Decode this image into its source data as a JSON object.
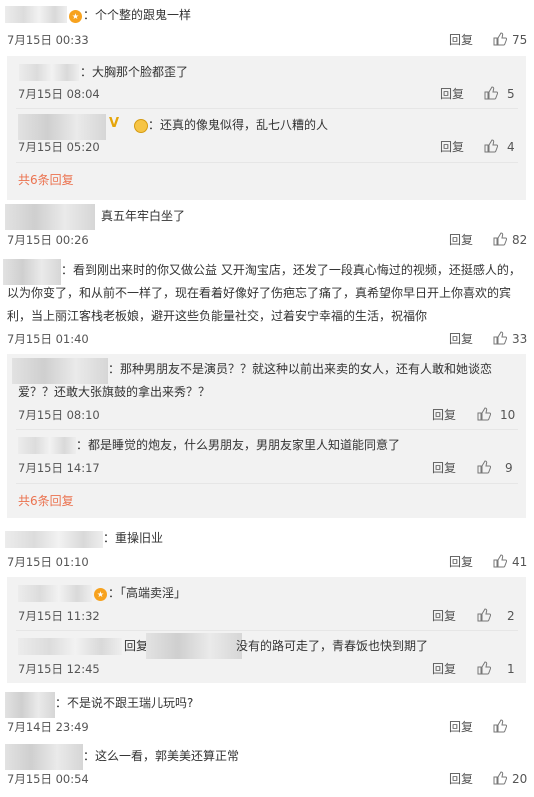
{
  "actions": {
    "reply": "回复"
  },
  "comments": [
    {
      "text": "：个个整的跟鬼一样",
      "time": "7月15日 00:33",
      "likes": "75",
      "subs": [
        {
          "text": "：大胸那个脸都歪了",
          "time": "7月15日 08:04",
          "likes": "5"
        },
        {
          "mark": "V",
          "text": "：还真的像鬼似得，乱七八糟的人",
          "time": "7月15日 05:20",
          "likes": "4"
        }
      ],
      "more": "共6条回复"
    },
    {
      "text": "真五年牢白坐了",
      "time": "7月15日 00:26",
      "likes": "82"
    },
    {
      "lines": [
        "：看到刚出来时的你又做公益 又开淘宝店，还发了一段真心悔过的视频，还挺感人的，",
        "以为你变了，和从前不一样了，现在看着好像好了伤疤忘了痛了，真希望你早日开上你喜欢的宾",
        "利，当上丽江客栈老板娘，避开这些负能量社交，过着安宁幸福的生活，祝福你"
      ],
      "time": "7月15日 01:40",
      "likes": "33",
      "subs": [
        {
          "lines": [
            "：那种男朋友不是演员？？就这种以前出来卖的女人，还有人敢和她谈恋",
            "爱？？还敢大张旗鼓的拿出来秀？？"
          ],
          "time": "7月15日 08:10",
          "likes": "10"
        },
        {
          "text": "：都是睡觉的炮友，什么男朋友，男朋友家里人知道能同意了",
          "time": "7月15日 14:17",
          "likes": "9"
        }
      ],
      "more": "共6条回复"
    },
    {
      "text": "：重操旧业",
      "time": "7月15日 01:10",
      "likes": "41",
      "subs": [
        {
          "text": "：「高端卖淫」",
          "time": "7月15日 11:32",
          "likes": "2"
        },
        {
          "text_a": "回复",
          "text_b": "没有的路可走了，青春饭也快到期了",
          "time": "7月15日 12:45",
          "likes": "1"
        }
      ]
    },
    {
      "text": "：不是说不跟王瑞儿玩吗?",
      "time": "7月14日 23:49",
      "likes": ""
    },
    {
      "text": "：这么一看，郭美美还算正常",
      "time": "7月15日 00:54",
      "likes": "20"
    }
  ]
}
